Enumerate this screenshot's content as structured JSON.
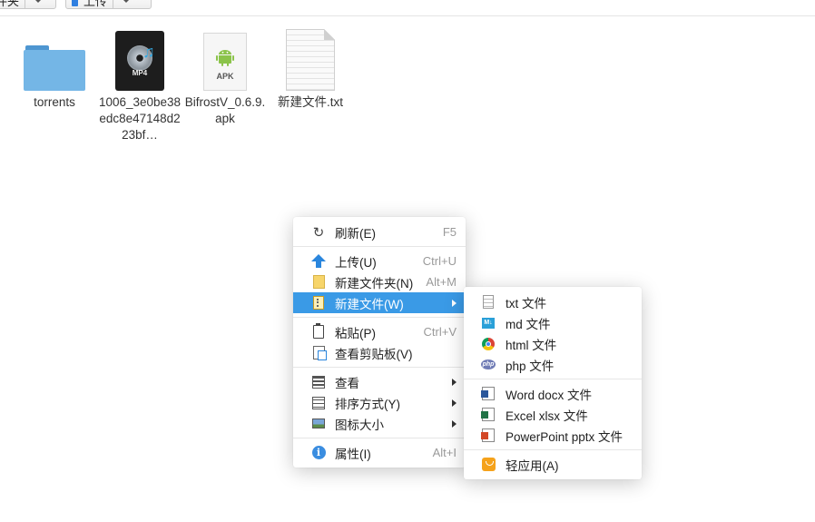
{
  "toolbar": {
    "left_button_label": "件夹",
    "upload_button_label": "上传"
  },
  "files": [
    {
      "name": "torrents",
      "icon": "folder-icon"
    },
    {
      "name": "1006_3e0be38edc8e47148d223bf…",
      "icon": "mp4-file-icon",
      "badge": "MP4"
    },
    {
      "name": "BifrostV_0.6.9.apk",
      "icon": "apk-file-icon",
      "badge": "APK"
    },
    {
      "name": "新建文件.txt",
      "icon": "txt-file-icon"
    }
  ],
  "context_menu": {
    "items": [
      {
        "label": "刷新(E)",
        "shortcut": "F5",
        "icon": "refresh-icon"
      },
      {
        "label": "上传(U)",
        "shortcut": "Ctrl+U",
        "icon": "upload-icon"
      },
      {
        "label": "新建文件夹(N)",
        "shortcut": "Alt+M",
        "icon": "new-folder-icon"
      },
      {
        "label": "新建文件(W)",
        "shortcut": "",
        "icon": "new-file-icon",
        "has_submenu": true,
        "active": true
      },
      {
        "label": "粘贴(P)",
        "shortcut": "Ctrl+V",
        "icon": "paste-icon"
      },
      {
        "label": "查看剪贴板(V)",
        "shortcut": "",
        "icon": "clipboard-icon"
      },
      {
        "label": "查看",
        "shortcut": "",
        "icon": "view-icon",
        "has_submenu": true
      },
      {
        "label": "排序方式(Y)",
        "shortcut": "",
        "icon": "sort-icon",
        "has_submenu": true
      },
      {
        "label": "图标大小",
        "shortcut": "",
        "icon": "icon-size-icon",
        "has_submenu": true
      },
      {
        "label": "属性(I)",
        "shortcut": "Alt+I",
        "icon": "info-icon"
      }
    ]
  },
  "submenu": {
    "items": [
      {
        "label": "txt 文件",
        "icon": "txt-icon"
      },
      {
        "label": "md 文件",
        "icon": "md-icon"
      },
      {
        "label": "html 文件",
        "icon": "chrome-icon"
      },
      {
        "label": "php 文件",
        "icon": "php-icon"
      },
      {
        "label": "Word docx 文件",
        "icon": "word-icon"
      },
      {
        "label": "Excel xlsx 文件",
        "icon": "excel-icon"
      },
      {
        "label": "PowerPoint pptx 文件",
        "icon": "powerpoint-icon"
      },
      {
        "label": "轻应用(A)",
        "icon": "light-app-icon"
      }
    ]
  },
  "colors": {
    "menu_active": "#3a9ae6",
    "folder": "#74b6e6"
  }
}
